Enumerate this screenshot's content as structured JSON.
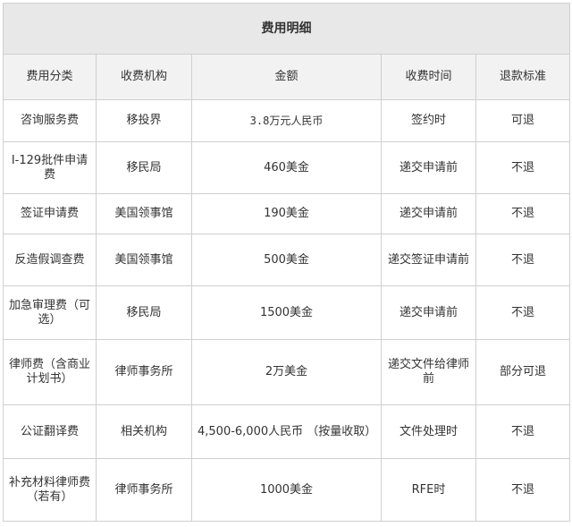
{
  "table": {
    "title": "费用明细",
    "headers": [
      "费用分类",
      "收费机构",
      "金额",
      "收费时间",
      "退款标准"
    ],
    "rows": [
      [
        "咨询服务费",
        "移投界",
        "3.8万元人民币",
        "签约时",
        "可退"
      ],
      [
        "I-129批件申请费",
        "移民局",
        "460美金",
        "递交申请前",
        "不退"
      ],
      [
        "签证申请费",
        "美国领事馆",
        "190美金",
        "递交申请前",
        "不退"
      ],
      [
        "反造假调查费",
        "美国领事馆",
        "500美金",
        "递交签证申请前",
        "不退"
      ],
      [
        "加急审理费（可选）",
        "移民局",
        "1500美金",
        "递交申请前",
        "不退"
      ],
      [
        "律师费（含商业计划书）",
        "律师事务所",
        "2万美金",
        "递交文件给律师前",
        "部分可退"
      ],
      [
        "公证翻译费",
        "相关机构",
        "4,500-6,000人民币 （按量收取）",
        "文件处理时",
        "不退"
      ],
      [
        "补充材料律师费（若有）",
        "律师事务所",
        "1000美金",
        "RFE时",
        "不退"
      ]
    ]
  }
}
